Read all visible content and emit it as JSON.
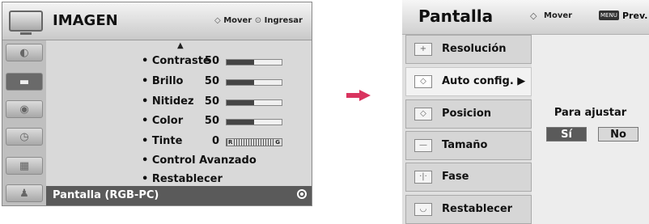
{
  "left_panel": {
    "title": "IMAGEN",
    "help_move_symbol": "◇",
    "help_move": "Mover",
    "help_enter_symbol": "⊙",
    "help_enter": "Ingresar",
    "scroll_up": "▲",
    "side_icons": [
      "picture-icon",
      "screen-icon",
      "audio-icon",
      "clock-icon",
      "option-icon",
      "lock-icon"
    ],
    "items": [
      {
        "label": "• Contraste",
        "value": "50",
        "level": 0.5
      },
      {
        "label": "• Brillo",
        "value": "50",
        "level": 0.5
      },
      {
        "label": "• Nitidez",
        "value": "50",
        "level": 0.5
      },
      {
        "label": "• Color",
        "value": "50",
        "level": 0.5
      },
      {
        "label": "• Tinte",
        "value": "0",
        "tint_r": "R",
        "tint_g": "G"
      },
      {
        "label": "• Control Avanzado"
      },
      {
        "label": "• Restablecer"
      }
    ],
    "selected_item": "Pantalla (RGB-PC)"
  },
  "arrow_color": "#d9345f",
  "right_panel": {
    "title": "Pantalla",
    "help_move_symbol": "◇",
    "help_move": "Mover",
    "menu_key": "MENU",
    "help_prev": "Prev.",
    "items": [
      {
        "label": "Resolución",
        "icon": "resolution-icon",
        "glyph": "+"
      },
      {
        "label": "Auto config. ▶",
        "icon": "auto-config-icon",
        "glyph": "◇"
      },
      {
        "label": "Posicion",
        "icon": "position-icon",
        "glyph": "◇"
      },
      {
        "label": "Tamaño",
        "icon": "size-icon",
        "glyph": "—"
      },
      {
        "label": "Fase",
        "icon": "phase-icon",
        "glyph": "·|·"
      },
      {
        "label": "Restablecer",
        "icon": "reset-icon",
        "glyph": "◡"
      }
    ],
    "prompt": "Para ajustar",
    "yes": "Sí",
    "no": "No"
  }
}
